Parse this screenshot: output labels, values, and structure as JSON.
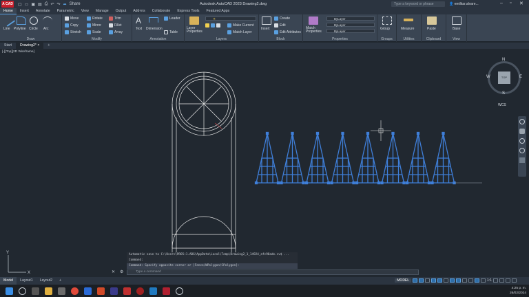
{
  "titlebar": {
    "app_button": "A CAD",
    "share": "Share",
    "title": "Autodesk AutoCAD 2023    Drawing2.dwg",
    "search_placeholder": "Type a keyword or phrase",
    "user": "emilkar.alvare..."
  },
  "tabs": [
    "Home",
    "Insert",
    "Annotate",
    "Parametric",
    "View",
    "Manage",
    "Output",
    "Add-ins",
    "Collaborate",
    "Express Tools",
    "Featured Apps"
  ],
  "ribbon": {
    "draw": {
      "title": "Draw",
      "line": "Line",
      "polyline": "Polyline",
      "circle": "Circle",
      "arc": "Arc"
    },
    "modify": {
      "title": "Modify",
      "move": "Move",
      "rotate": "Rotate",
      "trim": "Trim",
      "copy": "Copy",
      "mirror": "Mirror",
      "fillet": "Fillet",
      "stretch": "Stretch",
      "scale": "Scale",
      "array": "Array"
    },
    "annotation": {
      "title": "Annotation",
      "text": "Text",
      "dimension": "Dimension",
      "leader": "Leader",
      "table": "Table"
    },
    "layers": {
      "title": "Layers",
      "layer_props": "Layer Properties",
      "make_current": "Make Current",
      "match_layer": "Match Layer"
    },
    "block": {
      "title": "Block",
      "insert": "Insert",
      "create": "Create",
      "edit": "Edit",
      "edit_attributes": "Edit Attributes"
    },
    "properties": {
      "title": "Properties",
      "match": "Match Properties",
      "bylayer1": "ByLayer",
      "bylayer2": "ByLayer",
      "bylayer3": "ByLayer"
    },
    "groups": {
      "title": "Groups",
      "group": "Group"
    },
    "utilities": {
      "title": "Utilities",
      "measure": "Measure"
    },
    "clipboard": {
      "title": "Clipboard",
      "paste": "Paste"
    },
    "view": {
      "title": "View",
      "base": "Base"
    }
  },
  "doc_tabs": {
    "start": "Start",
    "drawing": "Drawing2*",
    "add": "+"
  },
  "viewport": {
    "label": "[-][Top][2D Wireframe]"
  },
  "viewcube": {
    "n": "N",
    "w": "W",
    "e": "E",
    "s": "S",
    "face": "TOP",
    "wcs": "WCS"
  },
  "command": {
    "history": [
      "Automatic save to C:\\Users\\PRO5~1.ABG\\AppData\\Local\\Temp\\Drawing2_1_14924_afc98ade.sv$ ...",
      "Command:",
      "Command: Specify opposite corner or [Fence/WPolygon/CPolygon]:"
    ],
    "input_placeholder": "Type a command"
  },
  "layouts": [
    "Model",
    "Layout1",
    "Layout2",
    "+"
  ],
  "status": {
    "model": "MODEL",
    "scale": "1:1"
  },
  "tray": {
    "time": "4:25 p. m.",
    "date": "26/02/2024"
  },
  "colors": {
    "accent": "#3f7fd9",
    "ribbon": "#3a4553",
    "canvas": "#212830"
  }
}
